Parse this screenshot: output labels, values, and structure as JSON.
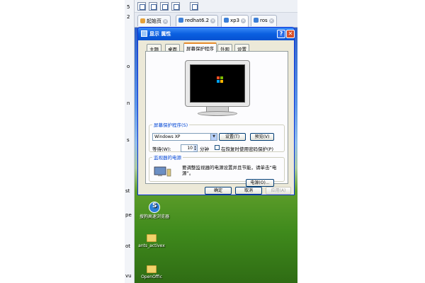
{
  "host": {
    "tabs": [
      {
        "label": "起始页",
        "icon": "home-icon"
      },
      {
        "label": "redhat6.2",
        "icon": "vm-icon"
      },
      {
        "label": "xp3",
        "icon": "vm-icon"
      },
      {
        "label": "ros",
        "icon": "vm-icon"
      }
    ],
    "left_labels": [
      "5",
      "2",
      "o",
      "n",
      "s",
      "st",
      "pe",
      "ot",
      "vu"
    ],
    "desktop_icons": [
      {
        "label": "搜狗高速浏览器",
        "icon": "sogou-browser-icon"
      },
      {
        "label": "ants_activex",
        "icon": "folder-icon"
      },
      {
        "label": "OpenOffic",
        "icon": "folder-icon"
      }
    ]
  },
  "dialog": {
    "title": "显示 属性",
    "help_glyph": "?",
    "close_glyph": "✕",
    "tabs": [
      "主题",
      "桌面",
      "屏幕保护程序",
      "外观",
      "设置"
    ],
    "active_tab": "屏幕保护程序",
    "screensaver": {
      "group_label": "屏幕保护程序(S)",
      "selected": "Windows XP",
      "settings_button": "设置(T)",
      "preview_button": "预览(V)",
      "wait_label": "等待(W):",
      "wait_value": "10",
      "wait_unit": "分钟",
      "resume_label": "在恢复时使用密码保护(P)",
      "resume_checked": false
    },
    "power": {
      "group_label": "监视器的电源",
      "description": "要调整监视器的电源设置并且节能，请单击“电源”。",
      "power_button": "电源(O)..."
    },
    "buttons": {
      "ok": "确定",
      "cancel": "取消",
      "apply": "应用(A)"
    }
  }
}
